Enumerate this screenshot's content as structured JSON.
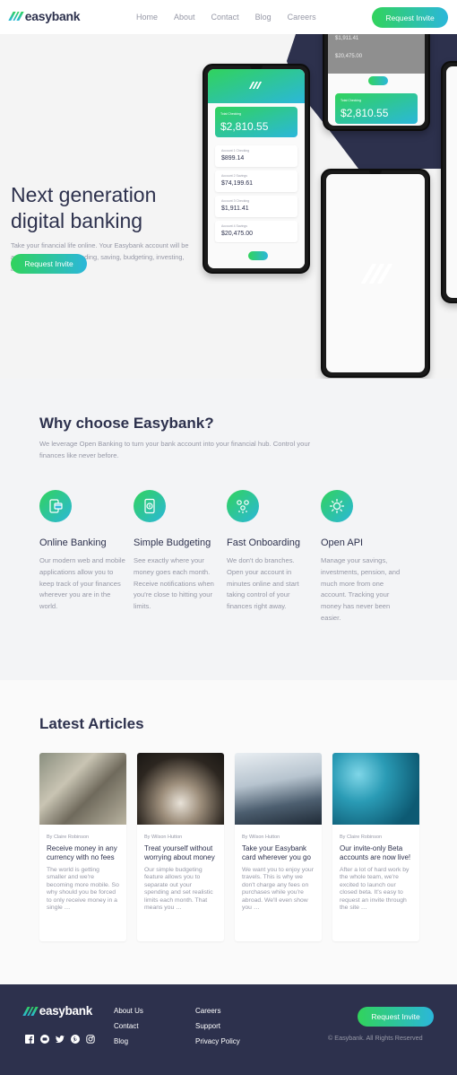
{
  "header": {
    "logo_text": "easybank",
    "nav": [
      "Home",
      "About",
      "Contact",
      "Blog",
      "Careers"
    ],
    "cta_label": "Request Invite"
  },
  "hero": {
    "title": "Next generation digital banking",
    "description": "Take your financial life online. Your Easybank account will be a one-stop-shop for spending, saving, budgeting, investing, and much more.",
    "cta_label": "Request Invite",
    "phone_main": {
      "total_label": "Total Checking",
      "total_value": "$2,810.55",
      "accounts": [
        {
          "label": "Account 1 Checking",
          "value": "$899.14"
        },
        {
          "label": "Account 2 Savings",
          "value": "$74,199.61"
        },
        {
          "label": "Account 3 Checking",
          "value": "$1,911.41"
        },
        {
          "label": "Account 4 Savings",
          "value": "$20,475.00"
        }
      ]
    },
    "phone_top": {
      "rows": [
        {
          "value": "$1,911.41"
        },
        {
          "value": "$20,475.00"
        }
      ],
      "total_label": "Total Checking",
      "total_value": "$2,810.55"
    }
  },
  "why": {
    "title": "Why choose Easybank?",
    "description": "We leverage Open Banking to turn your bank account into your financial hub. Control your finances like never before.",
    "features": [
      {
        "icon": "online-banking-icon",
        "title": "Online Banking",
        "text": "Our modern web and mobile applications allow you to keep track of your finances wherever you are in the world."
      },
      {
        "icon": "budgeting-icon",
        "title": "Simple Budgeting",
        "text": "See exactly where your money goes each month. Receive notifications when you're close to hitting your limits."
      },
      {
        "icon": "onboarding-icon",
        "title": "Fast Onboarding",
        "text": "We don't do branches. Open your account in minutes online and start taking control of your finances right away."
      },
      {
        "icon": "api-icon",
        "title": "Open API",
        "text": "Manage your savings, investments, pension, and much more from one account. Tracking your money has never been easier."
      }
    ]
  },
  "articles": {
    "title": "Latest Articles",
    "items": [
      {
        "author": "By Claire Robinson",
        "title": "Receive money in any currency with no fees",
        "excerpt": "The world is getting smaller and we're becoming more mobile. So why should you be forced to only receive money in a single …"
      },
      {
        "author": "By Wilson Hutton",
        "title": "Treat yourself without worrying about money",
        "excerpt": "Our simple budgeting feature allows you to separate out your spending and set realistic limits each month. That means you …"
      },
      {
        "author": "By Wilson Hutton",
        "title": "Take your Easybank card wherever you go",
        "excerpt": "We want you to enjoy your travels. This is why we don't charge any fees on purchases while you're abroad. We'll even show you …"
      },
      {
        "author": "By Claire Robinson",
        "title": "Our invite-only Beta accounts are now live!",
        "excerpt": "After a lot of hard work by the whole team, we're excited to launch our closed beta. It's easy to request an invite through the site …"
      }
    ]
  },
  "footer": {
    "logo_text": "easybank",
    "social": [
      "facebook-icon",
      "youtube-icon",
      "twitter-icon",
      "pinterest-icon",
      "instagram-icon"
    ],
    "col1": [
      "About Us",
      "Contact",
      "Blog"
    ],
    "col2": [
      "Careers",
      "Support",
      "Privacy Policy"
    ],
    "cta_label": "Request Invite",
    "copyright": "© Easybank. All Rights Reserved"
  },
  "colors": {
    "dark_blue": "#2d314d",
    "lime_green": "#31d35c",
    "bright_cyan": "#2bb7da",
    "grayish_blue": "#9698a6",
    "light_gray": "#f3f4f6"
  }
}
